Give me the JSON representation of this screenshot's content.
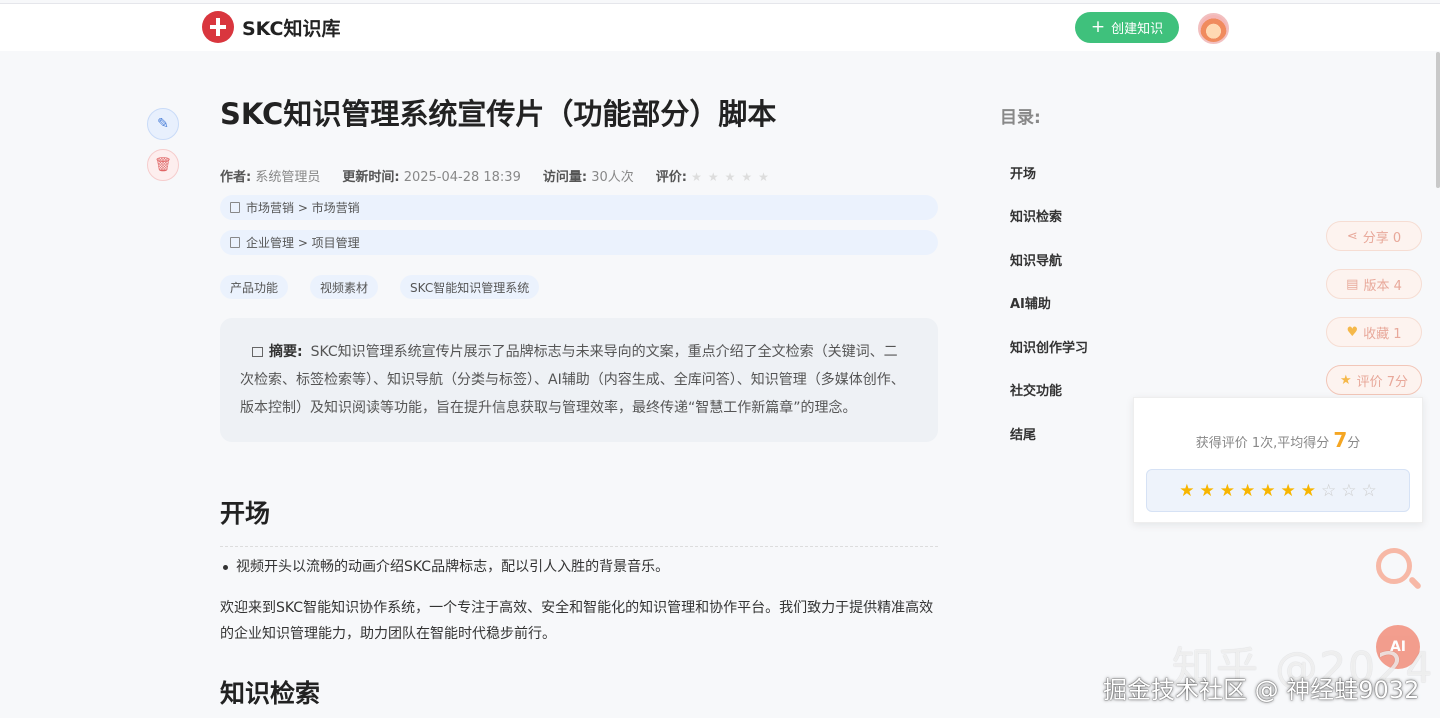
{
  "header": {
    "logo_text": "SKC知识库",
    "create_label": "创建知识"
  },
  "article": {
    "title": "SKC知识管理系统宣传片（功能部分）脚本",
    "meta": {
      "author_label": "作者:",
      "author": "系统管理员",
      "updated_label": "更新时间:",
      "updated": "2025-04-28 18:39",
      "visits_label": "访问量:",
      "visits": "30人次",
      "rating_label": "评价:"
    },
    "categories": [
      "市场营销 > 市场营销",
      "企业管理 > 项目管理"
    ],
    "tags": [
      "产品功能",
      "视频素材",
      "SKC智能知识管理系统"
    ],
    "summary_label": "摘要:",
    "summary": "SKC知识管理系统宣传片展示了品牌标志与未来导向的文案，重点介绍了全文检索（关键词、二次检索、标签检索等）、知识导航（分类与标签）、AI辅助（内容生成、全库问答）、知识管理（多媒体创作、版本控制）及知识阅读等功能，旨在提升信息获取与管理效率，最终传递“智慧工作新篇章”的理念。",
    "section1": {
      "heading": "开场",
      "bullet": "视频开头以流畅的动画介绍SKC品牌标志，配以引人入胜的背景音乐。",
      "paragraph": "欢迎来到SKC智能知识协作系统，一个专注于高效、安全和智能化的知识管理和协作平台。我们致力于提供精准高效的企业知识管理能力，助力团队在智能时代稳步前行。"
    },
    "next_heading": "知识检索"
  },
  "toc": {
    "title": "目录:",
    "items": [
      "开场",
      "知识检索",
      "知识导航",
      "AI辅助",
      "知识创作学习",
      "社交功能",
      "结尾"
    ]
  },
  "actions": {
    "share": "分享 0",
    "version": "版本 4",
    "favorite": "收藏 1",
    "rate": "评价 7分"
  },
  "rating_popup": {
    "prefix": "获得评价 1次,平均得分",
    "score": "7",
    "suffix": "分",
    "stars_filled": 7,
    "stars_total": 10
  },
  "ai_button": "AI",
  "watermark": {
    "line1": "知乎 @2024",
    "line2": "掘金技术社区 @ 神经蛙9032"
  },
  "colors": {
    "accent_green": "#3fc17c",
    "brand_red": "#d9363e",
    "star": "#f7b500"
  }
}
